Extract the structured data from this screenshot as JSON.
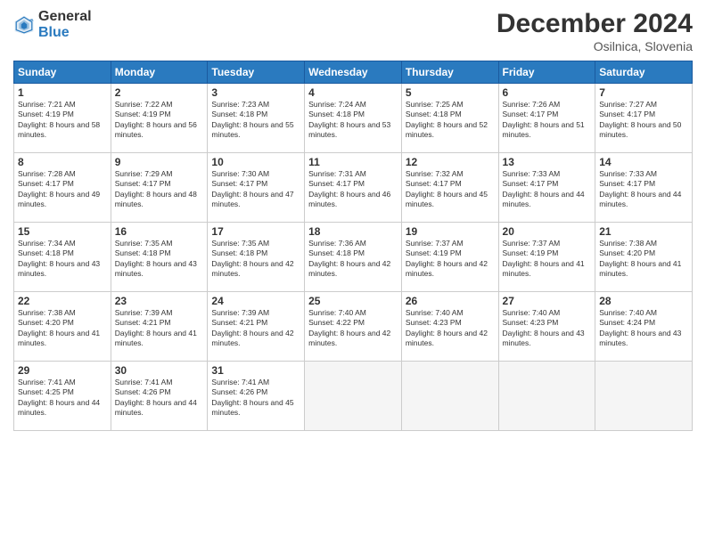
{
  "header": {
    "logo_general": "General",
    "logo_blue": "Blue",
    "month_title": "December 2024",
    "location": "Osilnica, Slovenia"
  },
  "days_of_week": [
    "Sunday",
    "Monday",
    "Tuesday",
    "Wednesday",
    "Thursday",
    "Friday",
    "Saturday"
  ],
  "weeks": [
    [
      {
        "day": "1",
        "sunrise": "7:21 AM",
        "sunset": "4:19 PM",
        "daylight": "8 hours and 58 minutes."
      },
      {
        "day": "2",
        "sunrise": "7:22 AM",
        "sunset": "4:19 PM",
        "daylight": "8 hours and 56 minutes."
      },
      {
        "day": "3",
        "sunrise": "7:23 AM",
        "sunset": "4:18 PM",
        "daylight": "8 hours and 55 minutes."
      },
      {
        "day": "4",
        "sunrise": "7:24 AM",
        "sunset": "4:18 PM",
        "daylight": "8 hours and 53 minutes."
      },
      {
        "day": "5",
        "sunrise": "7:25 AM",
        "sunset": "4:18 PM",
        "daylight": "8 hours and 52 minutes."
      },
      {
        "day": "6",
        "sunrise": "7:26 AM",
        "sunset": "4:17 PM",
        "daylight": "8 hours and 51 minutes."
      },
      {
        "day": "7",
        "sunrise": "7:27 AM",
        "sunset": "4:17 PM",
        "daylight": "8 hours and 50 minutes."
      }
    ],
    [
      {
        "day": "8",
        "sunrise": "7:28 AM",
        "sunset": "4:17 PM",
        "daylight": "8 hours and 49 minutes."
      },
      {
        "day": "9",
        "sunrise": "7:29 AM",
        "sunset": "4:17 PM",
        "daylight": "8 hours and 48 minutes."
      },
      {
        "day": "10",
        "sunrise": "7:30 AM",
        "sunset": "4:17 PM",
        "daylight": "8 hours and 47 minutes."
      },
      {
        "day": "11",
        "sunrise": "7:31 AM",
        "sunset": "4:17 PM",
        "daylight": "8 hours and 46 minutes."
      },
      {
        "day": "12",
        "sunrise": "7:32 AM",
        "sunset": "4:17 PM",
        "daylight": "8 hours and 45 minutes."
      },
      {
        "day": "13",
        "sunrise": "7:33 AM",
        "sunset": "4:17 PM",
        "daylight": "8 hours and 44 minutes."
      },
      {
        "day": "14",
        "sunrise": "7:33 AM",
        "sunset": "4:17 PM",
        "daylight": "8 hours and 44 minutes."
      }
    ],
    [
      {
        "day": "15",
        "sunrise": "7:34 AM",
        "sunset": "4:18 PM",
        "daylight": "8 hours and 43 minutes."
      },
      {
        "day": "16",
        "sunrise": "7:35 AM",
        "sunset": "4:18 PM",
        "daylight": "8 hours and 43 minutes."
      },
      {
        "day": "17",
        "sunrise": "7:35 AM",
        "sunset": "4:18 PM",
        "daylight": "8 hours and 42 minutes."
      },
      {
        "day": "18",
        "sunrise": "7:36 AM",
        "sunset": "4:18 PM",
        "daylight": "8 hours and 42 minutes."
      },
      {
        "day": "19",
        "sunrise": "7:37 AM",
        "sunset": "4:19 PM",
        "daylight": "8 hours and 42 minutes."
      },
      {
        "day": "20",
        "sunrise": "7:37 AM",
        "sunset": "4:19 PM",
        "daylight": "8 hours and 41 minutes."
      },
      {
        "day": "21",
        "sunrise": "7:38 AM",
        "sunset": "4:20 PM",
        "daylight": "8 hours and 41 minutes."
      }
    ],
    [
      {
        "day": "22",
        "sunrise": "7:38 AM",
        "sunset": "4:20 PM",
        "daylight": "8 hours and 41 minutes."
      },
      {
        "day": "23",
        "sunrise": "7:39 AM",
        "sunset": "4:21 PM",
        "daylight": "8 hours and 41 minutes."
      },
      {
        "day": "24",
        "sunrise": "7:39 AM",
        "sunset": "4:21 PM",
        "daylight": "8 hours and 42 minutes."
      },
      {
        "day": "25",
        "sunrise": "7:40 AM",
        "sunset": "4:22 PM",
        "daylight": "8 hours and 42 minutes."
      },
      {
        "day": "26",
        "sunrise": "7:40 AM",
        "sunset": "4:23 PM",
        "daylight": "8 hours and 42 minutes."
      },
      {
        "day": "27",
        "sunrise": "7:40 AM",
        "sunset": "4:23 PM",
        "daylight": "8 hours and 43 minutes."
      },
      {
        "day": "28",
        "sunrise": "7:40 AM",
        "sunset": "4:24 PM",
        "daylight": "8 hours and 43 minutes."
      }
    ],
    [
      {
        "day": "29",
        "sunrise": "7:41 AM",
        "sunset": "4:25 PM",
        "daylight": "8 hours and 44 minutes."
      },
      {
        "day": "30",
        "sunrise": "7:41 AM",
        "sunset": "4:26 PM",
        "daylight": "8 hours and 44 minutes."
      },
      {
        "day": "31",
        "sunrise": "7:41 AM",
        "sunset": "4:26 PM",
        "daylight": "8 hours and 45 minutes."
      },
      null,
      null,
      null,
      null
    ]
  ],
  "labels": {
    "sunrise": "Sunrise:",
    "sunset": "Sunset:",
    "daylight": "Daylight:"
  }
}
